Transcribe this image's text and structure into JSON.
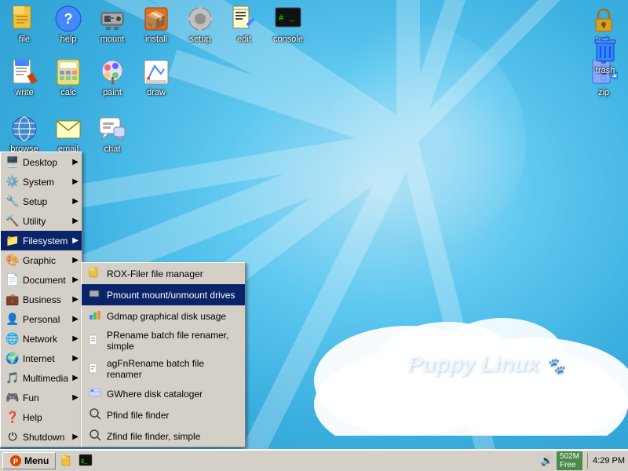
{
  "desktop": {
    "bg_color": "#4ab8e8",
    "puppy_text": "Puppy Linux"
  },
  "top_icons": [
    {
      "label": "file",
      "icon": "🗂️",
      "name": "file"
    },
    {
      "label": "help",
      "icon": "❓",
      "name": "help"
    },
    {
      "label": "mount",
      "icon": "💾",
      "name": "mount"
    },
    {
      "label": "install",
      "icon": "📦",
      "name": "install"
    },
    {
      "label": "setup",
      "icon": "🔧",
      "name": "setup"
    },
    {
      "label": "edit",
      "icon": "📝",
      "name": "edit"
    },
    {
      "label": "console",
      "icon": "🖥️",
      "name": "console"
    }
  ],
  "row2_icons": [
    {
      "label": "write",
      "icon": "📄",
      "name": "write"
    },
    {
      "label": "calc",
      "icon": "🧮",
      "name": "calc"
    },
    {
      "label": "paint",
      "icon": "🎨",
      "name": "paint"
    },
    {
      "label": "draw",
      "icon": "✏️",
      "name": "draw"
    }
  ],
  "row3_icons": [
    {
      "label": "browse",
      "icon": "🌐",
      "name": "browse"
    },
    {
      "label": "email",
      "icon": "📧",
      "name": "email"
    },
    {
      "label": "chat",
      "icon": "💬",
      "name": "chat"
    }
  ],
  "right_icons": [
    {
      "label": "lock",
      "icon": "🔒",
      "name": "lock"
    },
    {
      "label": "zip",
      "icon": "📥",
      "name": "zip"
    },
    {
      "label": "trash",
      "icon": "🗑️",
      "name": "trash"
    }
  ],
  "start_menu": {
    "items": [
      {
        "label": "Desktop",
        "icon": "🖥️",
        "name": "desktop-menu",
        "has_arrow": true
      },
      {
        "label": "System",
        "icon": "⚙️",
        "name": "system-menu",
        "has_arrow": true
      },
      {
        "label": "Setup",
        "icon": "🔧",
        "name": "setup-menu",
        "has_arrow": true
      },
      {
        "label": "Utility",
        "icon": "🔨",
        "name": "utility-menu",
        "has_arrow": true
      },
      {
        "label": "Filesystem",
        "icon": "📁",
        "name": "filesystem-menu",
        "has_arrow": true,
        "active": true
      },
      {
        "label": "Graphic",
        "icon": "🎨",
        "name": "graphic-menu",
        "has_arrow": true
      },
      {
        "label": "Document",
        "icon": "📄",
        "name": "document-menu",
        "has_arrow": true
      },
      {
        "label": "Business",
        "icon": "💼",
        "name": "business-menu",
        "has_arrow": true
      },
      {
        "label": "Personal",
        "icon": "👤",
        "name": "personal-menu",
        "has_arrow": true
      },
      {
        "label": "Network",
        "icon": "🌐",
        "name": "network-menu",
        "has_arrow": true
      },
      {
        "label": "Internet",
        "icon": "🌍",
        "name": "internet-menu",
        "has_arrow": true
      },
      {
        "label": "Multimedia",
        "icon": "🎵",
        "name": "multimedia-menu",
        "has_arrow": true
      },
      {
        "label": "Fun",
        "icon": "🎮",
        "name": "fun-menu",
        "has_arrow": true
      },
      {
        "label": "Help",
        "icon": "❓",
        "name": "help-menu",
        "has_arrow": false
      },
      {
        "label": "Shutdown",
        "icon": "⏻",
        "name": "shutdown-menu",
        "has_arrow": true
      }
    ]
  },
  "filesystem_submenu": {
    "items": [
      {
        "label": "ROX-Filer file manager",
        "icon": "📁",
        "name": "rox-filer"
      },
      {
        "label": "Pmount mount/unmount drives",
        "icon": "💾",
        "name": "pmount",
        "selected": true
      },
      {
        "label": "Gdmap graphical disk usage",
        "icon": "📊",
        "name": "gdmap"
      },
      {
        "label": "PRename batch file renamer, simple",
        "icon": "✏️",
        "name": "prename"
      },
      {
        "label": "agFnRename batch file renamer",
        "icon": "✏️",
        "name": "agfnrename"
      },
      {
        "label": "GWhere disk cataloger",
        "icon": "🗃️",
        "name": "gwhere"
      },
      {
        "label": "Pfind file finder",
        "icon": "🔍",
        "name": "pfind"
      },
      {
        "label": "Zfind file finder, simple",
        "icon": "🔍",
        "name": "zfind"
      }
    ]
  },
  "taskbar": {
    "start_label": "Menu",
    "clock": "4:29 PM",
    "mem": "502M",
    "mem_label": "Free"
  }
}
